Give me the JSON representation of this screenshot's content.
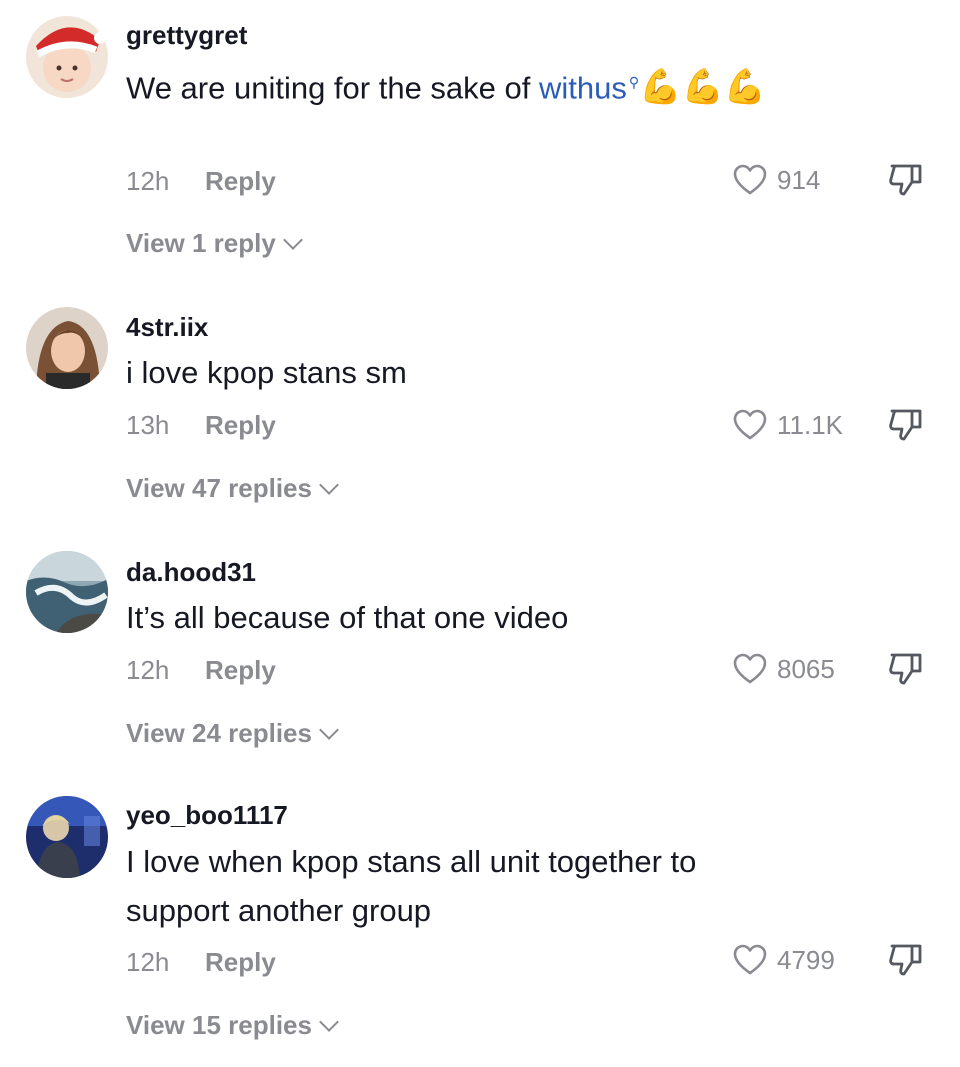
{
  "comments": [
    {
      "username": "grettygret",
      "text_before": "We are uniting for the sake of ",
      "hashtag": "withus",
      "emoji": "💪💪💪",
      "time": "12h",
      "reply_label": "Reply",
      "likes": "914",
      "view_replies": "View 1 reply"
    },
    {
      "username": "4str.iix",
      "text": "i love kpop stans sm",
      "time": "13h",
      "reply_label": "Reply",
      "likes": "11.1K",
      "view_replies": "View 47 replies"
    },
    {
      "username": "da.hood31",
      "text": "It’s all because of that one video",
      "time": "12h",
      "reply_label": "Reply",
      "likes": "8065",
      "view_replies": "View 24 replies"
    },
    {
      "username": "yeo_boo1117",
      "text": "I love when kpop stans all unit together to support another group",
      "time": "12h",
      "reply_label": "Reply",
      "likes": "4799",
      "view_replies": "View 15 replies"
    }
  ],
  "icons": {
    "like": "heart-outline-icon",
    "dislike": "thumbs-down-icon",
    "hashtag_search": "search-icon"
  },
  "colors": {
    "text": "#161823",
    "secondary": "#8a8b91",
    "hashtag": "#2b5db8"
  }
}
